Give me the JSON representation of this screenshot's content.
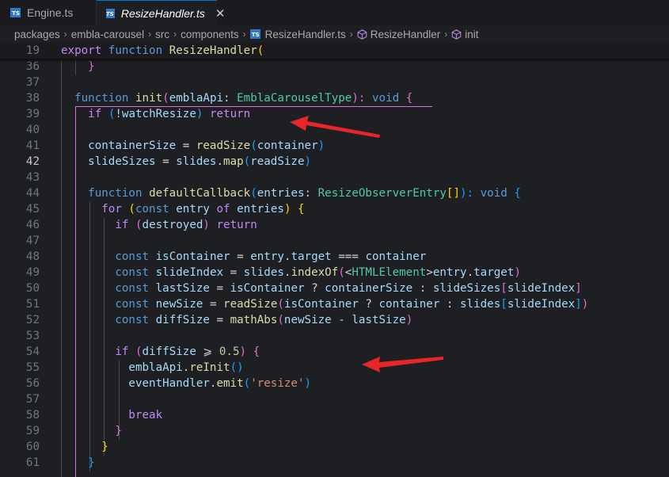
{
  "tabs": [
    {
      "label": "Engine.ts",
      "icon": "typescript-icon"
    },
    {
      "label": "ResizeHandler.ts",
      "icon": "typescript-icon",
      "close": "✕"
    }
  ],
  "ts_badge": "TS",
  "breadcrumb": {
    "segments": [
      "packages",
      "embla-carousel",
      "src",
      "components"
    ],
    "file": "ResizeHandler.ts",
    "symbol1": "ResizeHandler",
    "symbol2": "init",
    "separator": "›"
  },
  "editor": {
    "active_line": "42",
    "lines": [
      {
        "n": "19",
        "tokens": [
          [
            "export",
            "kw"
          ],
          [
            " ",
            ""
          ],
          [
            "function",
            "kb"
          ],
          [
            " ",
            ""
          ],
          [
            "ResizeHandler",
            "fn"
          ],
          [
            "(",
            "b1"
          ]
        ]
      },
      {
        "n": "36",
        "tokens": [
          [
            "    ",
            ""
          ],
          [
            "}",
            "b2"
          ]
        ]
      },
      {
        "n": "37",
        "tokens": []
      },
      {
        "n": "38",
        "tokens": [
          [
            "  ",
            ""
          ],
          [
            "function",
            "kb"
          ],
          [
            " ",
            ""
          ],
          [
            "init",
            "fn"
          ],
          [
            "(",
            "b2"
          ],
          [
            "emblaApi",
            "vr"
          ],
          [
            ": ",
            ""
          ],
          [
            "EmblaCarouselType",
            "ty"
          ],
          [
            "): ",
            "b2"
          ],
          [
            "void",
            "kb"
          ],
          [
            " ",
            ""
          ],
          [
            "{",
            "b2"
          ]
        ]
      },
      {
        "n": "39",
        "tokens": [
          [
            "    ",
            ""
          ],
          [
            "if",
            "kw"
          ],
          [
            " ",
            ""
          ],
          [
            "(",
            "b3"
          ],
          [
            "!",
            "op"
          ],
          [
            "watchResize",
            "vr"
          ],
          [
            ")",
            "b3"
          ],
          [
            " ",
            ""
          ],
          [
            "return",
            "kw"
          ]
        ]
      },
      {
        "n": "40",
        "tokens": []
      },
      {
        "n": "41",
        "tokens": [
          [
            "    ",
            ""
          ],
          [
            "containerSize",
            "vr"
          ],
          [
            " = ",
            ""
          ],
          [
            "readSize",
            "fn"
          ],
          [
            "(",
            "b3"
          ],
          [
            "container",
            "vr"
          ],
          [
            ")",
            "b3"
          ]
        ]
      },
      {
        "n": "42",
        "tokens": [
          [
            "    ",
            ""
          ],
          [
            "slideSizes",
            "vr"
          ],
          [
            " = ",
            ""
          ],
          [
            "slides",
            "vr"
          ],
          [
            ".",
            ""
          ],
          [
            "map",
            "fn"
          ],
          [
            "(",
            "b3"
          ],
          [
            "readSize",
            "vr"
          ],
          [
            ")",
            "b3"
          ]
        ]
      },
      {
        "n": "43",
        "tokens": []
      },
      {
        "n": "44",
        "tokens": [
          [
            "    ",
            ""
          ],
          [
            "function",
            "kb"
          ],
          [
            " ",
            ""
          ],
          [
            "defaultCallback",
            "fn"
          ],
          [
            "(",
            "b3"
          ],
          [
            "entries",
            "vr"
          ],
          [
            ": ",
            ""
          ],
          [
            "ResizeObserverEntry",
            "ty"
          ],
          [
            "[]",
            "b1"
          ],
          [
            "): ",
            "b3"
          ],
          [
            "void",
            "kb"
          ],
          [
            " ",
            ""
          ],
          [
            "{",
            "b3"
          ]
        ]
      },
      {
        "n": "45",
        "tokens": [
          [
            "      ",
            ""
          ],
          [
            "for",
            "kw"
          ],
          [
            " ",
            ""
          ],
          [
            "(",
            "b1"
          ],
          [
            "const",
            "kb"
          ],
          [
            " ",
            ""
          ],
          [
            "entry",
            "vr"
          ],
          [
            " ",
            ""
          ],
          [
            "of",
            "kw"
          ],
          [
            " ",
            ""
          ],
          [
            "entries",
            "vr"
          ],
          [
            ")",
            "b1"
          ],
          [
            " ",
            ""
          ],
          [
            "{",
            "b1"
          ]
        ]
      },
      {
        "n": "46",
        "tokens": [
          [
            "        ",
            ""
          ],
          [
            "if",
            "kw"
          ],
          [
            " ",
            ""
          ],
          [
            "(",
            "b2"
          ],
          [
            "destroyed",
            "vr"
          ],
          [
            ")",
            "b2"
          ],
          [
            " ",
            ""
          ],
          [
            "return",
            "kw"
          ]
        ]
      },
      {
        "n": "47",
        "tokens": []
      },
      {
        "n": "48",
        "tokens": [
          [
            "        ",
            ""
          ],
          [
            "const",
            "kb"
          ],
          [
            " ",
            ""
          ],
          [
            "isContainer",
            "vr"
          ],
          [
            " = ",
            ""
          ],
          [
            "entry",
            "vr"
          ],
          [
            ".",
            ""
          ],
          [
            "target",
            "vr"
          ],
          [
            " ",
            ""
          ],
          [
            "===",
            "op"
          ],
          [
            " ",
            ""
          ],
          [
            "container",
            "vr"
          ]
        ]
      },
      {
        "n": "49",
        "tokens": [
          [
            "        ",
            ""
          ],
          [
            "const",
            "kb"
          ],
          [
            " ",
            ""
          ],
          [
            "slideIndex",
            "vr"
          ],
          [
            " = ",
            ""
          ],
          [
            "slides",
            "vr"
          ],
          [
            ".",
            ""
          ],
          [
            "indexOf",
            "fn"
          ],
          [
            "(",
            "b2"
          ],
          [
            "<",
            ""
          ],
          [
            "HTMLElement",
            "ty"
          ],
          [
            ">",
            ""
          ],
          [
            "entry",
            "vr"
          ],
          [
            ".",
            ""
          ],
          [
            "target",
            "vr"
          ],
          [
            ")",
            "b2"
          ]
        ]
      },
      {
        "n": "50",
        "tokens": [
          [
            "        ",
            ""
          ],
          [
            "const",
            "kb"
          ],
          [
            " ",
            ""
          ],
          [
            "lastSize",
            "vr"
          ],
          [
            " = ",
            ""
          ],
          [
            "isContainer",
            "vr"
          ],
          [
            " ? ",
            ""
          ],
          [
            "containerSize",
            "vr"
          ],
          [
            " : ",
            ""
          ],
          [
            "slideSizes",
            "vr"
          ],
          [
            "[",
            "b2"
          ],
          [
            "slideIndex",
            "vr"
          ],
          [
            "]",
            "b2"
          ]
        ]
      },
      {
        "n": "51",
        "tokens": [
          [
            "        ",
            ""
          ],
          [
            "const",
            "kb"
          ],
          [
            " ",
            ""
          ],
          [
            "newSize",
            "vr"
          ],
          [
            " = ",
            ""
          ],
          [
            "readSize",
            "fn"
          ],
          [
            "(",
            "b2"
          ],
          [
            "isContainer",
            "vr"
          ],
          [
            " ? ",
            ""
          ],
          [
            "container",
            "vr"
          ],
          [
            " : ",
            ""
          ],
          [
            "slides",
            "vr"
          ],
          [
            "[",
            "b3"
          ],
          [
            "slideIndex",
            "vr"
          ],
          [
            "]",
            "b3"
          ],
          [
            ")",
            "b2"
          ]
        ]
      },
      {
        "n": "52",
        "tokens": [
          [
            "        ",
            ""
          ],
          [
            "const",
            "kb"
          ],
          [
            " ",
            ""
          ],
          [
            "diffSize",
            "vr"
          ],
          [
            " = ",
            ""
          ],
          [
            "mathAbs",
            "fn"
          ],
          [
            "(",
            "b2"
          ],
          [
            "newSize",
            "vr"
          ],
          [
            " - ",
            ""
          ],
          [
            "lastSize",
            "vr"
          ],
          [
            ")",
            "b2"
          ]
        ]
      },
      {
        "n": "53",
        "tokens": []
      },
      {
        "n": "54",
        "tokens": [
          [
            "        ",
            ""
          ],
          [
            "if",
            "kw"
          ],
          [
            " ",
            ""
          ],
          [
            "(",
            "b2"
          ],
          [
            "diffSize",
            "vr"
          ],
          [
            " ",
            ""
          ],
          [
            "⩾",
            "op"
          ],
          [
            " ",
            ""
          ],
          [
            "0.5",
            "nm"
          ],
          [
            ")",
            "b2"
          ],
          [
            " ",
            ""
          ],
          [
            "{",
            "b2"
          ]
        ]
      },
      {
        "n": "55",
        "tokens": [
          [
            "          ",
            ""
          ],
          [
            "emblaApi",
            "vr"
          ],
          [
            ".",
            ""
          ],
          [
            "reInit",
            "fn"
          ],
          [
            "()",
            "b3"
          ]
        ]
      },
      {
        "n": "56",
        "tokens": [
          [
            "          ",
            ""
          ],
          [
            "eventHandler",
            "vr"
          ],
          [
            ".",
            ""
          ],
          [
            "emit",
            "fn"
          ],
          [
            "(",
            "b3"
          ],
          [
            "'resize'",
            "st"
          ],
          [
            ")",
            "b3"
          ]
        ]
      },
      {
        "n": "57",
        "tokens": []
      },
      {
        "n": "58",
        "tokens": [
          [
            "          ",
            ""
          ],
          [
            "break",
            "kw"
          ]
        ]
      },
      {
        "n": "59",
        "tokens": [
          [
            "        ",
            ""
          ],
          [
            "}",
            "b2"
          ]
        ]
      },
      {
        "n": "60",
        "tokens": [
          [
            "      ",
            ""
          ],
          [
            "}",
            "b1"
          ]
        ]
      },
      {
        "n": "61",
        "tokens": [
          [
            "    ",
            ""
          ],
          [
            "}",
            "b3"
          ]
        ]
      }
    ]
  },
  "colors": {
    "background": "#1e1f22",
    "annotation_arrow": "#e8262a",
    "ts_badge": "#3178c6",
    "active_tab_border": "#0078d4"
  }
}
